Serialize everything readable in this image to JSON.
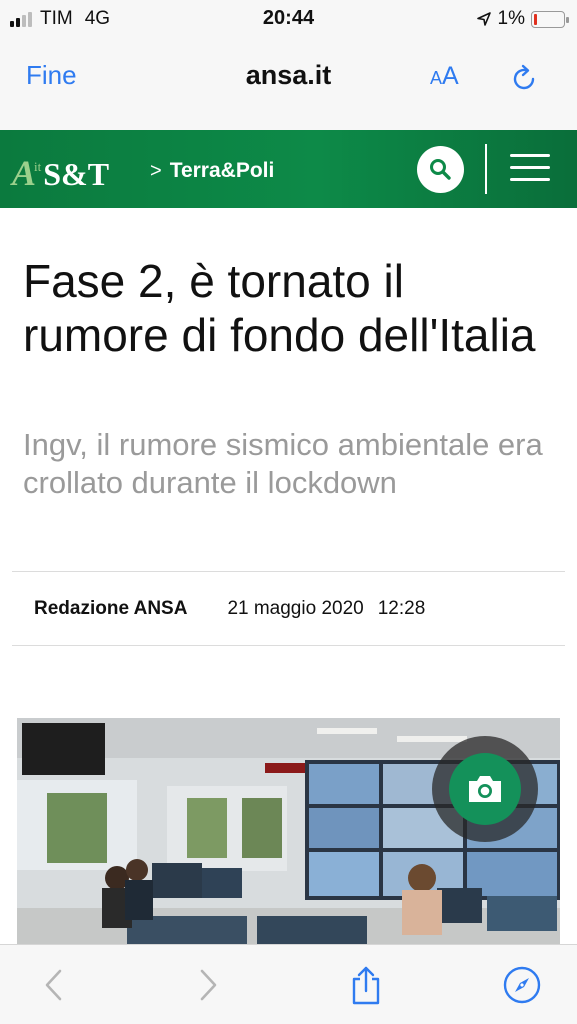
{
  "status_bar": {
    "carrier": "TIM",
    "network": "4G",
    "time": "20:44",
    "battery": "1%"
  },
  "browser": {
    "done_label": "Fine",
    "site": "ansa.it",
    "font_size_small": "A",
    "font_size_big": "A"
  },
  "site_header": {
    "logo_a": "A",
    "logo_it": "it",
    "logo_section": "S&T",
    "breadcrumb_separator": ">",
    "breadcrumb": "Terra&Poli"
  },
  "article": {
    "title": "Fase 2, è tornato il rumore di fondo dell'Italia",
    "subtitle": "Ingv, il rumore sismico ambientale era crollato durante il lockdown",
    "author": "Redazione ANSA",
    "date": "21 maggio 2020",
    "time": "12:28"
  },
  "colors": {
    "accent_blue": "#2f7bf0",
    "header_green": "#0d8a48",
    "camera_green": "#14915a",
    "subtitle_gray": "#9a9a9a"
  },
  "icons": [
    "location-arrow-icon",
    "battery-icon",
    "reload-icon",
    "search-icon",
    "hamburger-menu-icon",
    "camera-icon",
    "back-arrow-icon",
    "forward-arrow-icon",
    "share-icon",
    "compass-icon"
  ]
}
